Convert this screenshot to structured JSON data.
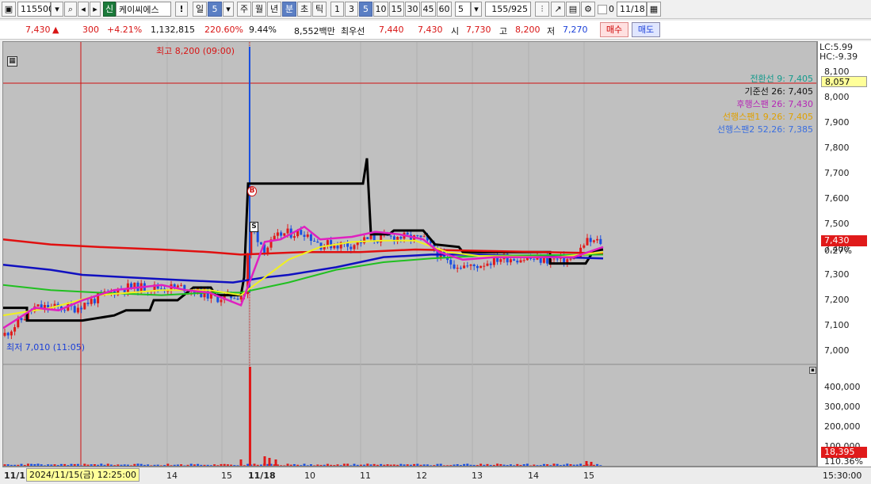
{
  "toolbar": {
    "code": "115500",
    "credit_badge": "신",
    "stock_name": "케이씨에스",
    "alert": "!",
    "period_day": "일",
    "period_day_count": "5",
    "week": "주",
    "month": "월",
    "year": "년",
    "minute": "분",
    "second": "초",
    "tick": "틱",
    "intervals": [
      "1",
      "3",
      "5",
      "10",
      "15",
      "30",
      "45",
      "60"
    ],
    "selected_interval": "5",
    "count_value": "5",
    "range": "155/925",
    "check_label": "0",
    "date": "11/18"
  },
  "quote": {
    "price": "7,430",
    "change": "300",
    "change_pct": "+4.21%",
    "volume": "1,132,815",
    "volume_ratio": "220.60%",
    "turnover": "9.44%",
    "amount": "8,552백만",
    "best_label": "최우선",
    "ask": "7,440",
    "bid": "7,430",
    "open_label": "시",
    "open": "7,730",
    "high_label": "고",
    "high": "8,200",
    "low_label": "저",
    "low": "7,270",
    "buy_button": "매수",
    "sell_button": "매도"
  },
  "chart": {
    "high_annotation": "최고 8,200 (09:00)",
    "low_annotation": "최저 7,010 (11:05)",
    "lc": "LC:5.99",
    "hc": "HC:-9.39",
    "crosshair_price": "8,057",
    "current_price": "7,430",
    "current_pct": "0.27%",
    "volume_value": "18,395",
    "volume_pct": "110.36%",
    "cursor_date": "2024/11/15(금) 12:25:00",
    "time_label": "15:30:00",
    "marker_buy": "B",
    "marker_sell": "S",
    "legend": [
      {
        "text": "전환선 9: 7,405",
        "color": "#159a8c"
      },
      {
        "text": "기준선 26: 7,405",
        "color": "#111111"
      },
      {
        "text": "후행스팬 26: 7,430",
        "color": "#b526b5"
      },
      {
        "text": "선행스팬1 9,26: 7,405",
        "color": "#e0a000"
      },
      {
        "text": "선행스팬2 52,26: 7,385",
        "color": "#3a6ee0"
      }
    ]
  },
  "chart_data": {
    "type": "line",
    "price_axis": [
      "8,100",
      "8,000",
      "7,900",
      "7,800",
      "7,700",
      "7,600",
      "7,500",
      "7,400",
      "7,300",
      "7,200",
      "7,100",
      "7,000"
    ],
    "volume_axis": [
      "400,000",
      "300,000",
      "200,000",
      "100,000"
    ],
    "x_labels": [
      "11/1",
      "14",
      "15",
      "11/18",
      "10",
      "11",
      "12",
      "13",
      "14",
      "15"
    ],
    "colors": {
      "up": "#e01a1a",
      "down": "#1a4fe0",
      "kijun": "#000000",
      "ma_red": "#e01010",
      "ma_blue": "#1010c0",
      "ma_green": "#20c020",
      "ma_yellow": "#f0f020",
      "ma_magenta": "#e020c0"
    }
  }
}
